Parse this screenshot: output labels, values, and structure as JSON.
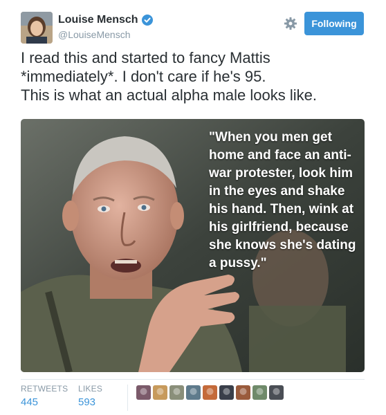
{
  "author": {
    "name": "Louise Mensch",
    "handle": "@LouiseMensch",
    "verified": true
  },
  "follow_button": {
    "label": "Following"
  },
  "tweet": {
    "lines": [
      "I read this and started to fancy Mattis",
      "*immediately*. I don't care if he's 95.",
      "This is what an actual alpha male looks like."
    ]
  },
  "media": {
    "quote_lines": [
      "\"When you men get",
      "home and face an anti-",
      "war protester, look him",
      "in the eyes and shake",
      "his hand. Then, wink at",
      "his girlfriend, because",
      "she knows she's dating",
      "a pussy.\""
    ]
  },
  "stats": {
    "retweets_label": "RETWEETS",
    "retweets_value": "445",
    "likes_label": "LIKES",
    "likes_value": "593"
  },
  "likers": [
    {
      "color": "#7b5a6a"
    },
    {
      "color": "#c79a5c"
    },
    {
      "color": "#8a8f7a"
    },
    {
      "color": "#5f7b8c"
    },
    {
      "color": "#c46a3a"
    },
    {
      "color": "#3a3f4a"
    },
    {
      "color": "#9a5b3c"
    },
    {
      "color": "#6f8a6a"
    },
    {
      "color": "#4a4e55"
    }
  ],
  "colors": {
    "accent": "#3b94d9",
    "muted": "#8899a6",
    "text": "#292f33"
  }
}
